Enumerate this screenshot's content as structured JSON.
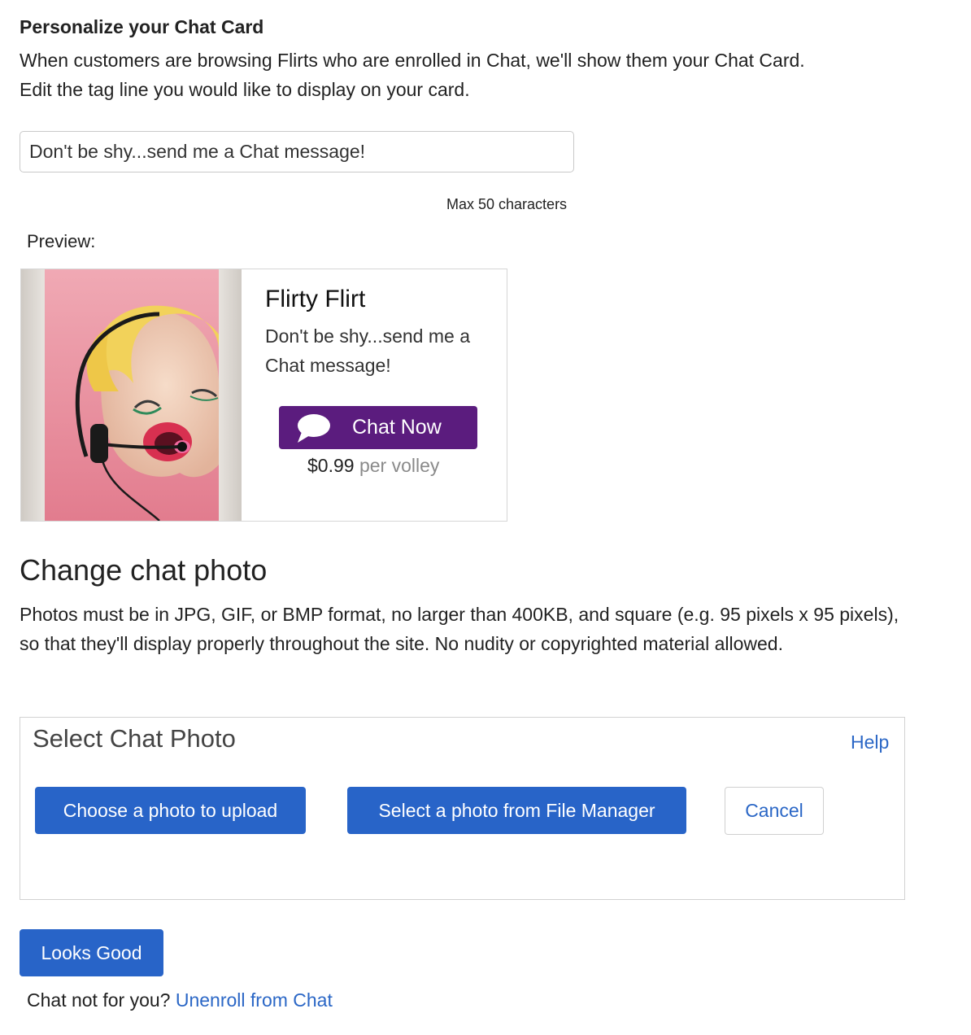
{
  "chat_card": {
    "heading": "Personalize your Chat Card",
    "description_line1": "When customers are browsing Flirts who are enrolled in Chat, we'll show them your Chat Card.",
    "description_line2": "Edit the tag line you would like to display on your card.",
    "tagline_value": "Don't be shy...send me a Chat message!",
    "max_note": "Max 50 characters",
    "preview_label": "Preview:"
  },
  "preview_card": {
    "name": "Flirty Flirt",
    "tagline": "Don't be shy...send me a Chat message!",
    "chat_button_label": "Chat Now",
    "price": "$0.99",
    "price_unit": "per volley",
    "button_color": "#5b1c7e"
  },
  "change_photo": {
    "heading": "Change chat photo",
    "description": "Photos must be in JPG, GIF, or BMP format, no larger than 400KB, and square (e.g. 95 pixels x 95 pixels), so that they'll display properly throughout the site. No nudity or copyrighted material allowed."
  },
  "select_photo": {
    "title": "Select Chat Photo",
    "help_label": "Help",
    "upload_label": "Choose a photo to upload",
    "file_manager_label": "Select a photo from File Manager",
    "cancel_label": "Cancel"
  },
  "footer": {
    "looks_good_label": "Looks Good",
    "unenroll_prompt": "Chat not for you?",
    "unenroll_link": "Unenroll from Chat"
  },
  "colors": {
    "primary_blue": "#2864c8",
    "link_blue": "#2b67c6",
    "chat_purple": "#5b1c7e"
  },
  "icons": [
    "speech-bubble-icon"
  ]
}
